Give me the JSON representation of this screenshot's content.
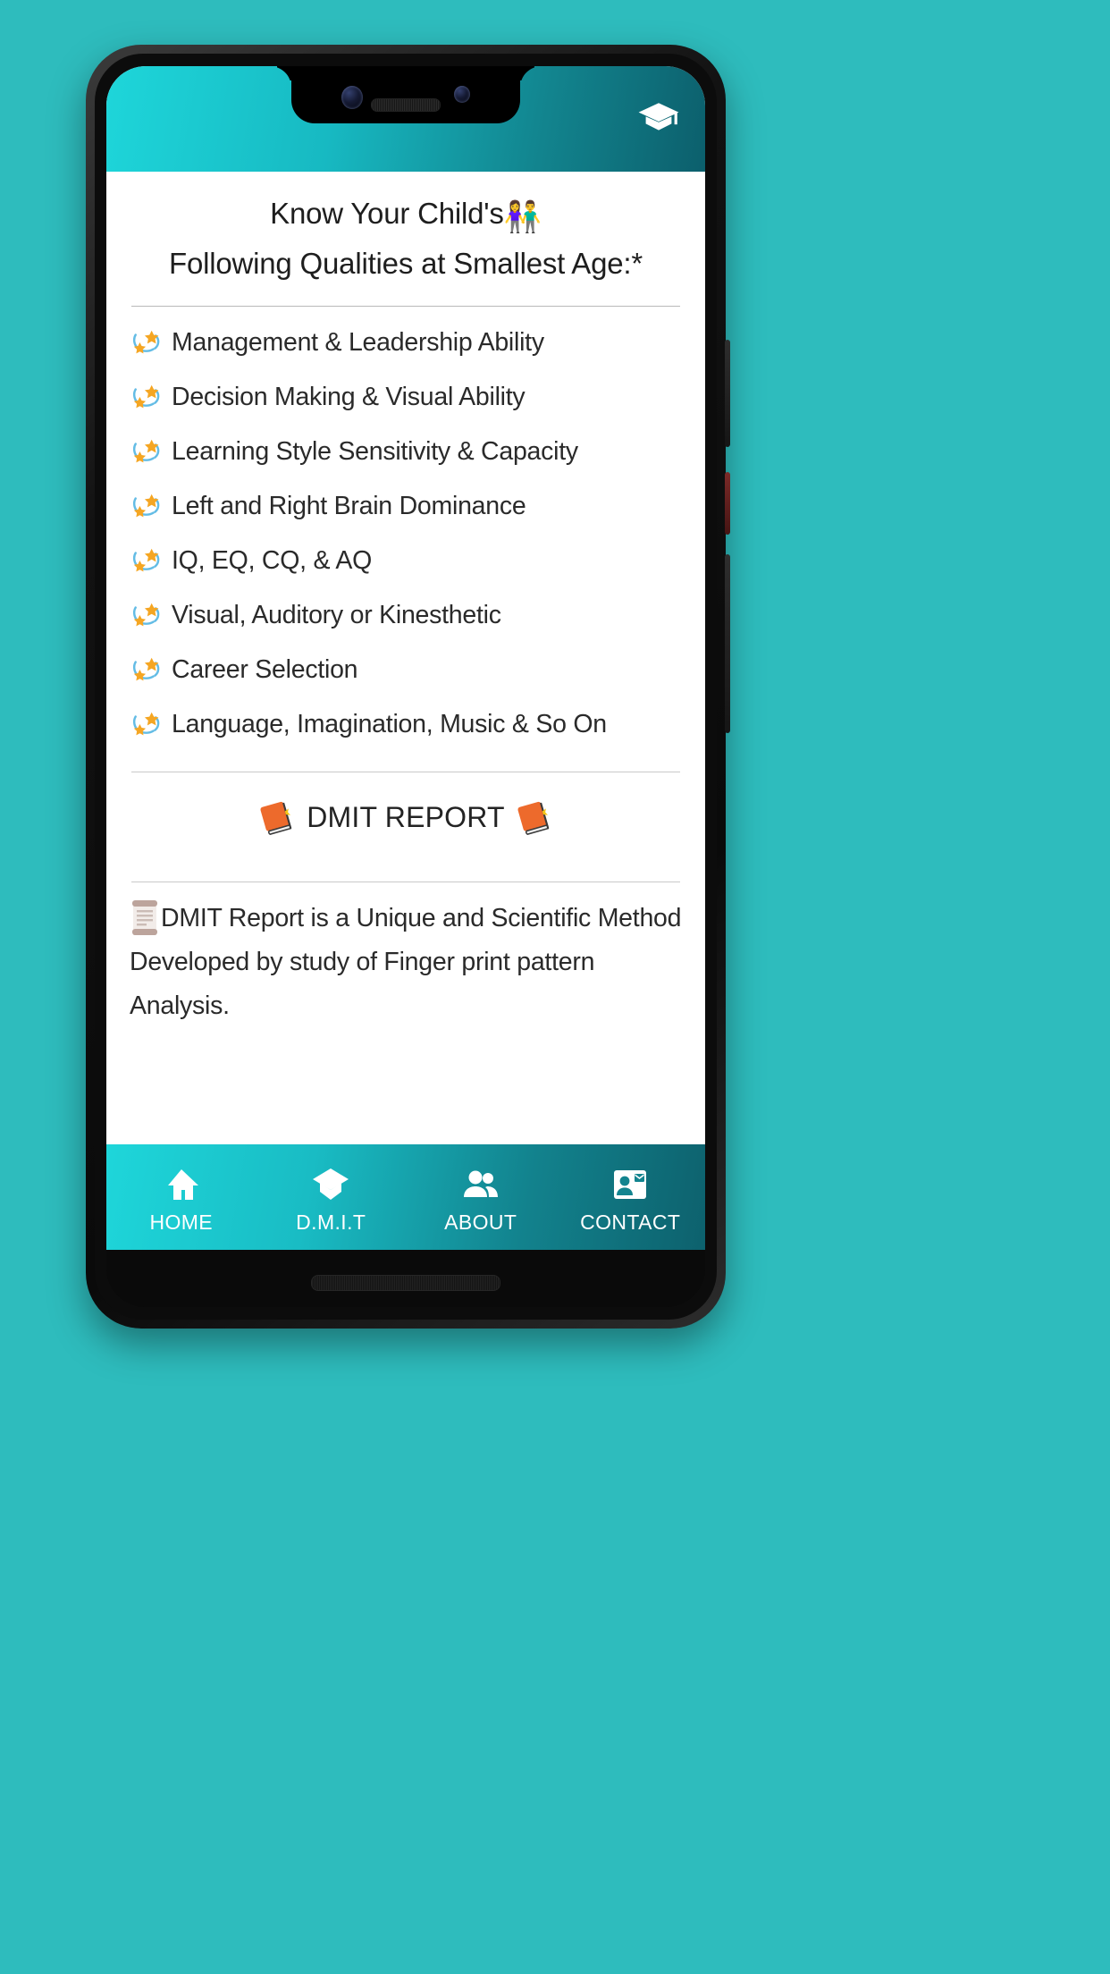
{
  "colors": {
    "page_background": "#2EBCBD",
    "appbar_gradient_start": "#1ED6DA",
    "appbar_gradient_end": "#0C5F6C",
    "bullet_star": "#F5A623",
    "bullet_swirl": "#63BCE5",
    "book_emoji": "#ED6A2C",
    "text_primary": "#2A2A2A"
  },
  "appbar": {
    "icon": "graduation-cap-icon"
  },
  "header": {
    "line1": "Know Your Child's",
    "line1_emoji": "👫",
    "line2": "Following Qualities at Smallest Age:*"
  },
  "qualities": {
    "bullet_icon": "dizzy-stars-icon",
    "items": [
      "Management & Leadership Ability",
      "Decision Making & Visual Ability",
      "Learning Style Sensitivity & Capacity",
      "Left and Right Brain Dominance",
      "IQ, EQ, CQ, & AQ",
      "Visual, Auditory or Kinesthetic",
      "Career Selection",
      "Language, Imagination, Music & So On"
    ]
  },
  "report": {
    "title": "DMIT REPORT",
    "title_icon_left": "closed-book-icon",
    "title_icon_right": "closed-book-icon",
    "body_icon": "scroll-icon",
    "body_line1": "DMIT Report is a Unique and Scientific Method",
    "body_line2": "Developed by study of Finger print pattern Analysis."
  },
  "bottom_nav": {
    "items": [
      {
        "label": "HOME",
        "icon": "home-icon",
        "active": true
      },
      {
        "label": "D.M.I.T",
        "icon": "graduation-cap-icon",
        "active": false
      },
      {
        "label": "ABOUT",
        "icon": "people-icon",
        "active": false
      },
      {
        "label": "CONTACT",
        "icon": "contact-card-icon",
        "active": false
      }
    ]
  }
}
